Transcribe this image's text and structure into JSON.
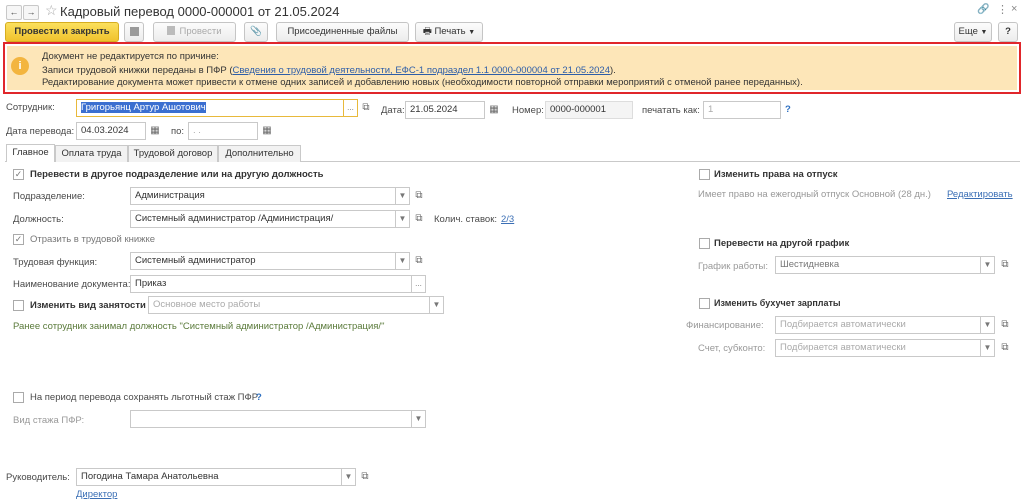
{
  "window": {
    "title": "Кадровый перевод 0000-000001 от 21.05.2024",
    "back_icon": "arrow-left-icon",
    "forward_icon": "arrow-right-icon",
    "star_icon": "star-icon",
    "link_icon": "link-icon",
    "more_icon": "more-icon",
    "close_icon": "close-icon"
  },
  "toolbar": {
    "post_close": "Провести и закрыть",
    "post": "Провести",
    "attached_files": "Присоединенные файлы",
    "print": "Печать",
    "more": "Еще",
    "help": "?"
  },
  "warning": {
    "line1": "Документ не редактируется по причине:",
    "line2_prefix": "Записи трудовой книжки переданы в ПФР (",
    "line2_link": "Сведения о трудовой деятельности, ЕФС-1 подраздел 1.1 0000-000004 от 21.05.2024",
    "line2_suffix": ").",
    "line3": "Редактирование документа может привести к отмене одних записей и добавлению новых (необходимости повторной отправки мероприятий с отменой ранее переданных)."
  },
  "header": {
    "employee_label": "Сотрудник:",
    "employee_value": "Григорьянц Артур Ашотович",
    "date_label": "Дата:",
    "date_value": "21.05.2024",
    "number_label": "Номер:",
    "number_value": "0000-000001",
    "print_as_label": "печатать как:",
    "print_as_value": "1",
    "help": "?",
    "transfer_date_label": "Дата перевода:",
    "transfer_date_value": "04.03.2024",
    "to_label": "по:",
    "to_value": " .  ."
  },
  "tabs": [
    "Главное",
    "Оплата труда",
    "Трудовой договор",
    "Дополнительно"
  ],
  "main": {
    "transfer_check": "Перевести в другое подразделение или на другую должность",
    "dept_label": "Подразделение:",
    "dept_value": "Администрация",
    "position_label": "Должность:",
    "position_value": "Системный администратор /Администрация/",
    "rates_label": "Колич. ставок:",
    "rates_value": "2/3",
    "reflect_check": "Отразить в трудовой книжке",
    "labor_func_label": "Трудовая функция:",
    "labor_func_value": "Системный администратор",
    "doc_name_label": "Наименование документа:",
    "doc_name_value": "Приказ",
    "employment_check": "Изменить вид занятости",
    "employment_value": "Основное место работы",
    "previous_note": "Ранее сотрудник занимал должность \"Системный администратор /Администрация/\"",
    "pfr_check": "На период перевода сохранять льготный стаж ПФР",
    "pfr_help": "?",
    "pfr_kind_label": "Вид стажа ПФР:",
    "pfr_kind_value": ""
  },
  "right": {
    "vacation_check": "Изменить права на отпуск",
    "vacation_text": "Имеет право на ежегодный отпуск Основной (28 дн.)",
    "edit_link": "Редактировать",
    "schedule_check": "Перевести на другой график",
    "schedule_label": "График работы:",
    "schedule_value": "Шестидневка",
    "accounting_check": "Изменить бухучет зарплаты",
    "financing_label": "Финансирование:",
    "financing_value": "Подбирается автоматически",
    "account_label": "Счет, субконто:",
    "account_value": "Подбирается автоматически"
  },
  "footer": {
    "manager_label": "Руководитель:",
    "manager_value": "Погодина Тамара Анатольевна",
    "manager_position": "Директор"
  },
  "colors": {
    "accent": "#f0c22d",
    "warning_bg": "#fde6b8",
    "warning_border": "#e0262b",
    "link": "#3b6fb5"
  }
}
